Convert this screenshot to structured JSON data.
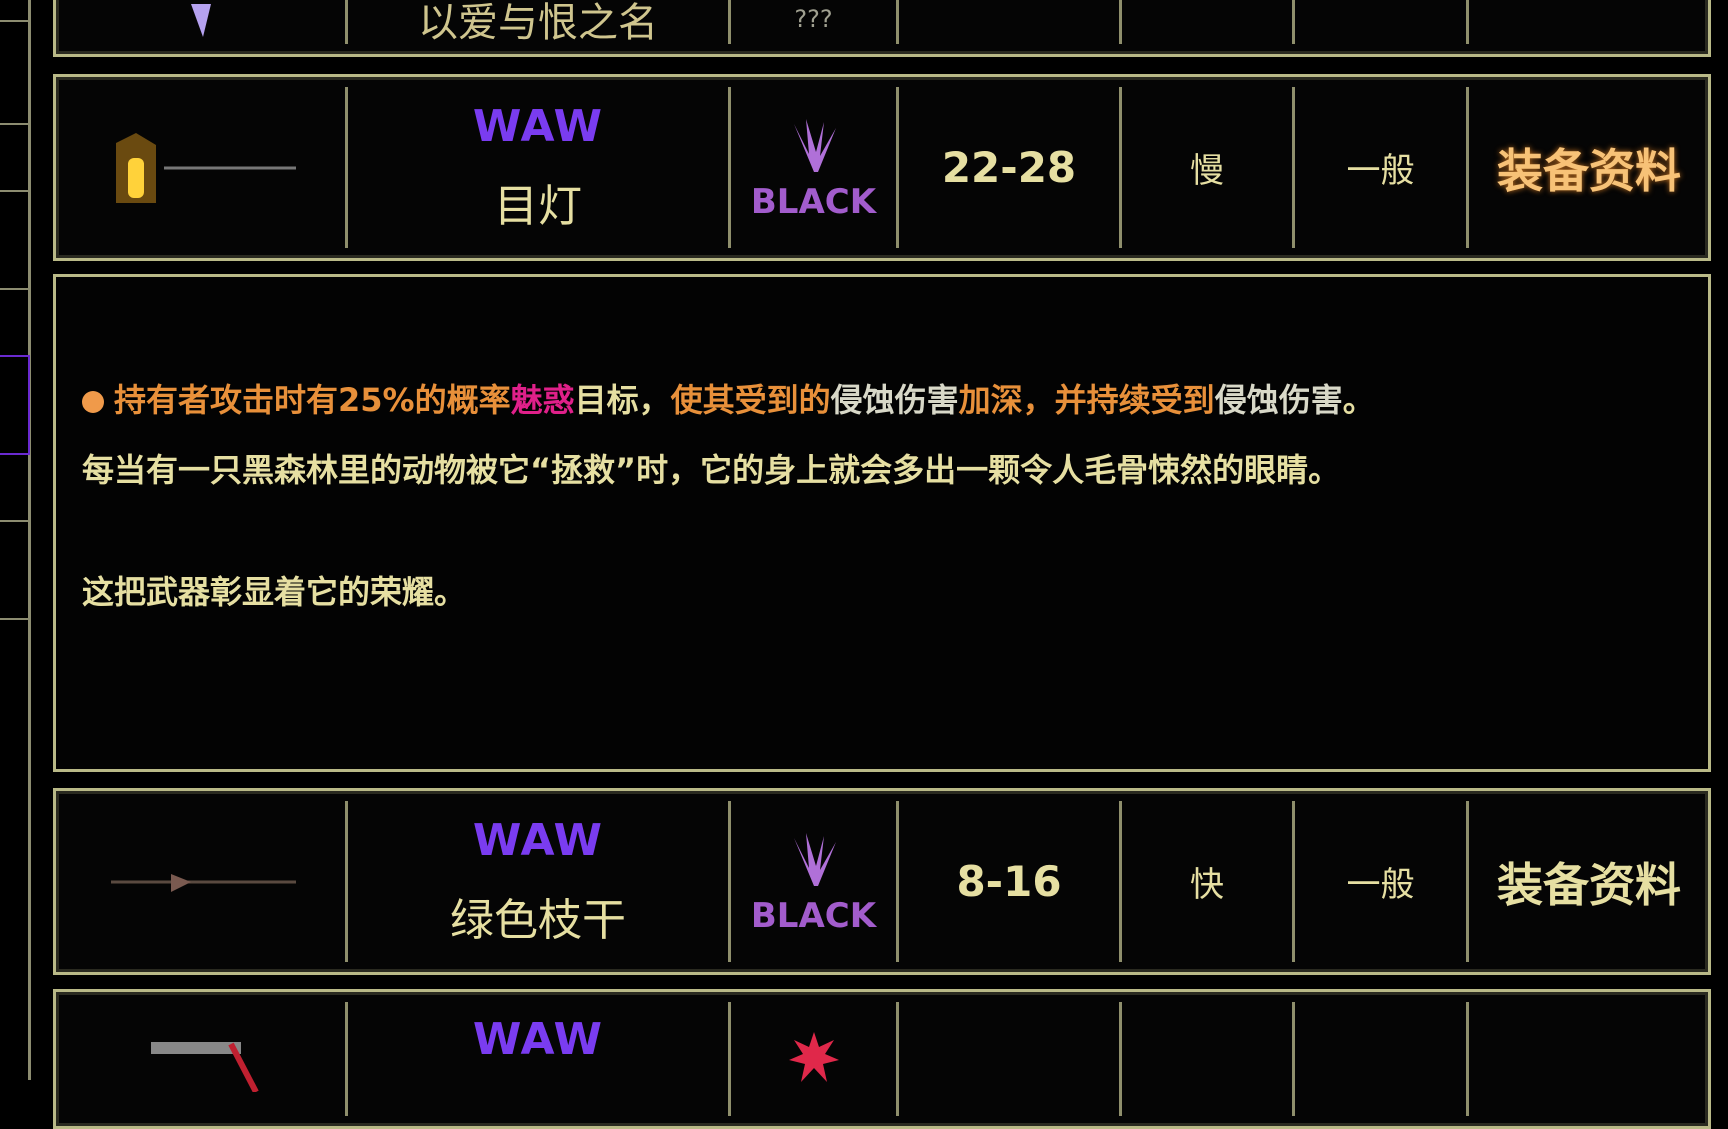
{
  "weapons": [
    {
      "name": "以爱与恨之名",
      "damage_type": "???",
      "icon": "purple-wand-icon"
    },
    {
      "level": "WAW",
      "name": "目灯",
      "damage_type": "BLACK",
      "damage": "22-28",
      "speed": "慢",
      "range": "一般",
      "info_label": "装备资料",
      "icon": "lantern-staff-icon",
      "highlighted": true
    },
    {
      "level": "WAW",
      "name": "绿色枝干",
      "damage_type": "BLACK",
      "damage": "8-16",
      "speed": "快",
      "range": "一般",
      "info_label": "装备资料",
      "icon": "green-branch-spear-icon"
    },
    {
      "level": "WAW",
      "icon": "red-weapon-icon",
      "damage_type_icon": "red-burst-icon"
    }
  ],
  "description": {
    "line1": [
      {
        "text": "持有者攻击时有25%的概率",
        "color": "#e8903a"
      },
      {
        "text": "魅惑",
        "color": "#e0208a"
      },
      {
        "text": "目标，",
        "color": "#e6dfa2"
      },
      {
        "text": "使其受到的",
        "color": "#e8903a"
      },
      {
        "text": "侵蚀伤害",
        "color": "#d8d8c8"
      },
      {
        "text": "加深，并持续受到",
        "color": "#e8903a"
      },
      {
        "text": "侵蚀伤害",
        "color": "#d8d8c8"
      },
      {
        "text": "。",
        "color": "#e6dfa2"
      }
    ],
    "line2": "每当有一只黑森林里的动物被它“拯救”时，它的身上就会多出一颗令人毛骨悚然的眼睛。",
    "line3": "这把武器彰显着它的荣耀。"
  },
  "colors": {
    "border": "#b9b987",
    "waw": "#7a3cf0",
    "black_damage": "#a25ccc",
    "text": "#e6dfa2",
    "info_highlight": "#f7c277"
  }
}
